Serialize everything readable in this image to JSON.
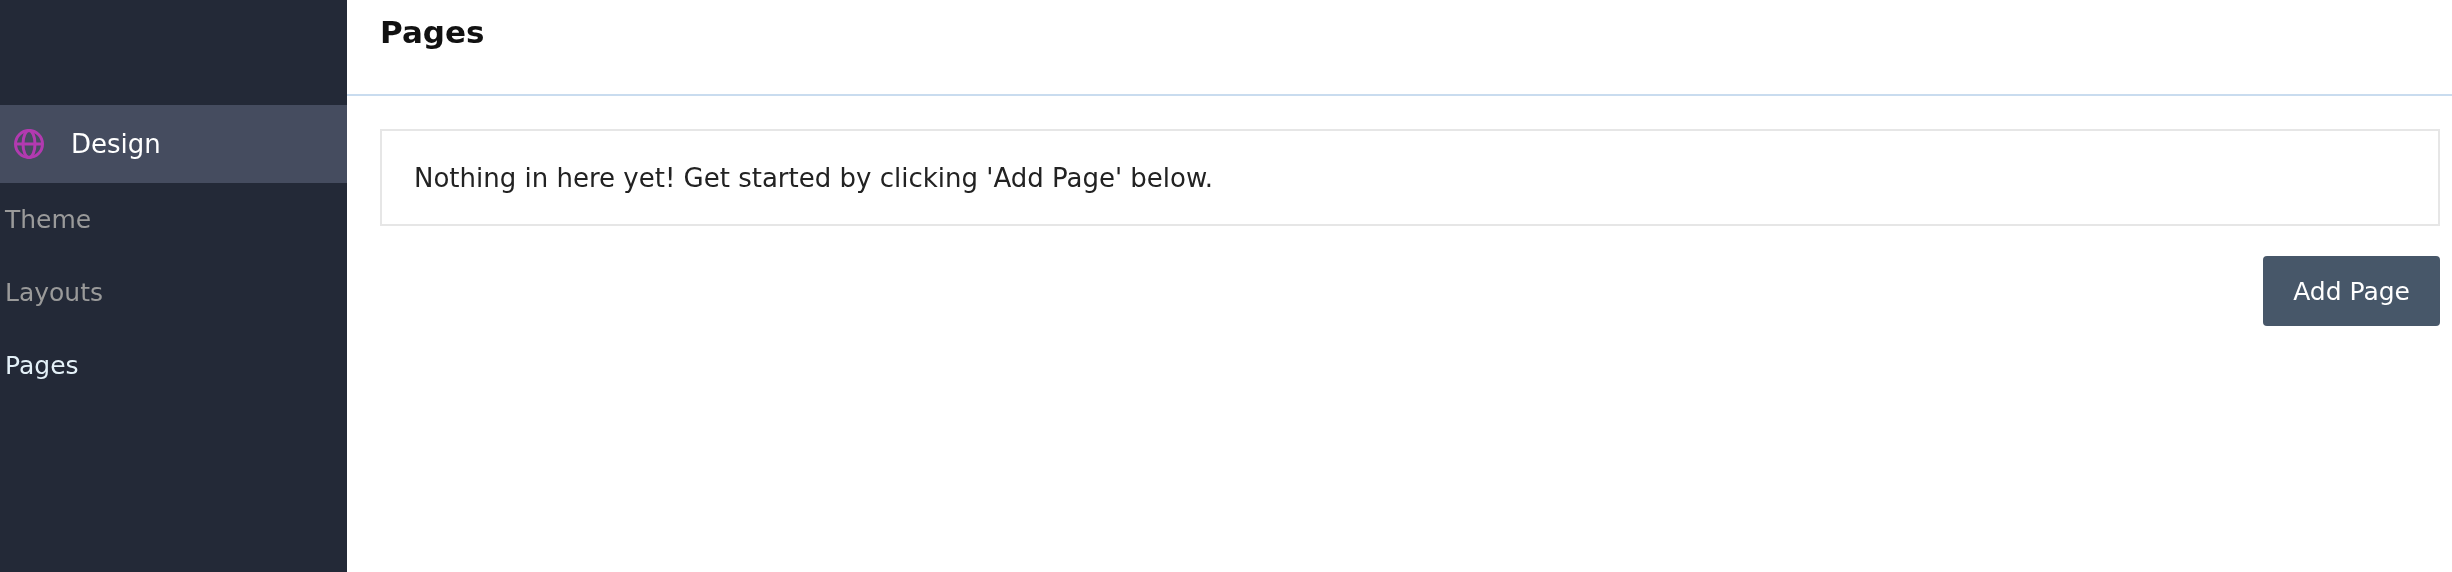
{
  "sidebar": {
    "section": {
      "label": "Design",
      "selected": true
    },
    "items": [
      {
        "label": "Theme",
        "selected": false
      },
      {
        "label": "Layouts",
        "selected": false
      },
      {
        "label": "Pages",
        "selected": true
      }
    ]
  },
  "header": {
    "title": "Pages"
  },
  "empty_message": "Nothing in here yet! Get started by clicking 'Add Page' below.",
  "buttons": [
    "Add Page"
  ]
}
